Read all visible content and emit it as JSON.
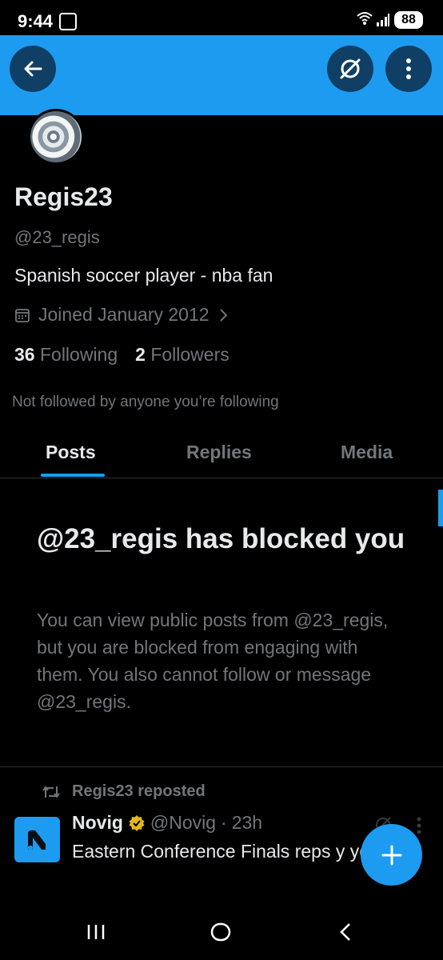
{
  "status_bar": {
    "time": "9:44",
    "battery": "88"
  },
  "header": {
    "back_icon": "arrow-left-icon",
    "grok_icon": "grok-icon",
    "more_icon": "more-vertical-icon"
  },
  "profile": {
    "name": "Regis23",
    "handle": "@23_regis",
    "bio": "Spanish soccer player - nba fan",
    "joined": "Joined January 2012",
    "following_count": "36",
    "following_label": "Following",
    "followers_count": "2",
    "followers_label": "Followers",
    "mutual_text": "Not followed by anyone you’re following"
  },
  "tabs": [
    {
      "label": "Posts",
      "active": true
    },
    {
      "label": "Replies",
      "active": false
    },
    {
      "label": "Media",
      "active": false
    }
  ],
  "blocked": {
    "title": "@23_regis has blocked you",
    "message": "You can view public posts from @23_regis, but you are blocked from engaging with them. You also cannot follow or message @23_regis."
  },
  "post": {
    "repost_label": "Regis23 reposted",
    "author_name": "Novig",
    "author_handle": "@Novig",
    "separator": "·",
    "time": "23h",
    "text": "Eastern Conference Finals reps y year:"
  },
  "colors": {
    "accent": "#1d9bf0",
    "background": "#000000",
    "primary_text": "#e7e9ea",
    "secondary_text": "#71767b"
  }
}
